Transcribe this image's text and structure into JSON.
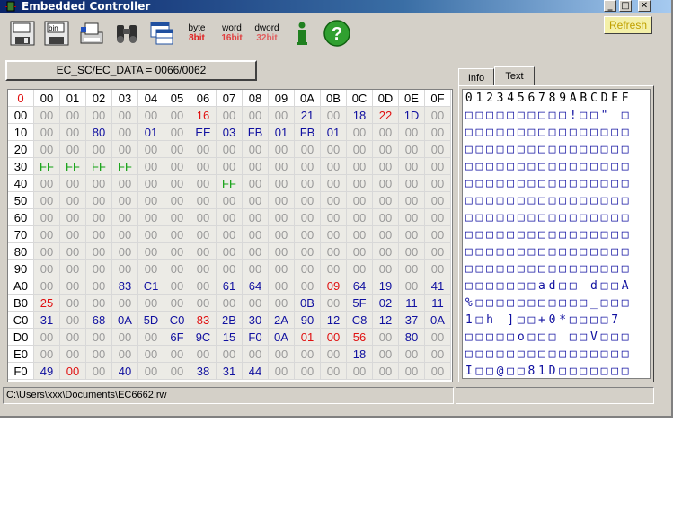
{
  "window": {
    "title": "Embedded Controller",
    "min_btn": "_",
    "max_btn": "□",
    "close_btn": "✕"
  },
  "toolbar": {
    "buttons": [
      "save-icon",
      "save-bin-icon",
      "print-icon",
      "binoculars-icon",
      "table-icon"
    ],
    "byte": {
      "top": "byte",
      "bottom": "8bit"
    },
    "word": {
      "top": "word",
      "bottom": "16bit"
    },
    "dword": {
      "top": "dword",
      "bottom": "32bit"
    },
    "info_icon": "i",
    "help_icon": "?",
    "refresh_label": "Refresh"
  },
  "colors": {
    "zero": "#9a9a9a",
    "blue": "#1010a0",
    "red": "#e01010",
    "green": "#10a010"
  },
  "ec_port_label": "EC_SC/EC_DATA = 0066/0062",
  "hex": {
    "corner": "0",
    "columns": [
      "00",
      "01",
      "02",
      "03",
      "04",
      "05",
      "06",
      "07",
      "08",
      "09",
      "0A",
      "0B",
      "0C",
      "0D",
      "0E",
      "0F"
    ],
    "rows": [
      {
        "label": "00",
        "cells": [
          "00",
          "00",
          "00",
          "00",
          "00",
          "00",
          "16",
          "00",
          "00",
          "00",
          "21",
          "00",
          "18",
          "22",
          "1D",
          "00"
        ],
        "colors": [
          "z",
          "z",
          "z",
          "z",
          "z",
          "z",
          "r",
          "z",
          "z",
          "z",
          "b",
          "z",
          "b",
          "r",
          "b",
          "z"
        ]
      },
      {
        "label": "10",
        "cells": [
          "00",
          "00",
          "80",
          "00",
          "01",
          "00",
          "EE",
          "03",
          "FB",
          "01",
          "FB",
          "01",
          "00",
          "00",
          "00",
          "00"
        ],
        "colors": [
          "z",
          "z",
          "b",
          "z",
          "b",
          "z",
          "b",
          "b",
          "b",
          "b",
          "b",
          "b",
          "z",
          "z",
          "z",
          "z"
        ]
      },
      {
        "label": "20",
        "cells": [
          "00",
          "00",
          "00",
          "00",
          "00",
          "00",
          "00",
          "00",
          "00",
          "00",
          "00",
          "00",
          "00",
          "00",
          "00",
          "00"
        ],
        "colors": [
          "z",
          "z",
          "z",
          "z",
          "z",
          "z",
          "z",
          "z",
          "z",
          "z",
          "z",
          "z",
          "z",
          "z",
          "z",
          "z"
        ]
      },
      {
        "label": "30",
        "cells": [
          "FF",
          "FF",
          "FF",
          "FF",
          "00",
          "00",
          "00",
          "00",
          "00",
          "00",
          "00",
          "00",
          "00",
          "00",
          "00",
          "00"
        ],
        "colors": [
          "g",
          "g",
          "g",
          "g",
          "z",
          "z",
          "z",
          "z",
          "z",
          "z",
          "z",
          "z",
          "z",
          "z",
          "z",
          "z"
        ]
      },
      {
        "label": "40",
        "cells": [
          "00",
          "00",
          "00",
          "00",
          "00",
          "00",
          "00",
          "FF",
          "00",
          "00",
          "00",
          "00",
          "00",
          "00",
          "00",
          "00"
        ],
        "colors": [
          "z",
          "z",
          "z",
          "z",
          "z",
          "z",
          "z",
          "g",
          "z",
          "z",
          "z",
          "z",
          "z",
          "z",
          "z",
          "z"
        ]
      },
      {
        "label": "50",
        "cells": [
          "00",
          "00",
          "00",
          "00",
          "00",
          "00",
          "00",
          "00",
          "00",
          "00",
          "00",
          "00",
          "00",
          "00",
          "00",
          "00"
        ],
        "colors": [
          "z",
          "z",
          "z",
          "z",
          "z",
          "z",
          "z",
          "z",
          "z",
          "z",
          "z",
          "z",
          "z",
          "z",
          "z",
          "z"
        ]
      },
      {
        "label": "60",
        "cells": [
          "00",
          "00",
          "00",
          "00",
          "00",
          "00",
          "00",
          "00",
          "00",
          "00",
          "00",
          "00",
          "00",
          "00",
          "00",
          "00"
        ],
        "colors": [
          "z",
          "z",
          "z",
          "z",
          "z",
          "z",
          "z",
          "z",
          "z",
          "z",
          "z",
          "z",
          "z",
          "z",
          "z",
          "z"
        ]
      },
      {
        "label": "70",
        "cells": [
          "00",
          "00",
          "00",
          "00",
          "00",
          "00",
          "00",
          "00",
          "00",
          "00",
          "00",
          "00",
          "00",
          "00",
          "00",
          "00"
        ],
        "colors": [
          "z",
          "z",
          "z",
          "z",
          "z",
          "z",
          "z",
          "z",
          "z",
          "z",
          "z",
          "z",
          "z",
          "z",
          "z",
          "z"
        ]
      },
      {
        "label": "80",
        "cells": [
          "00",
          "00",
          "00",
          "00",
          "00",
          "00",
          "00",
          "00",
          "00",
          "00",
          "00",
          "00",
          "00",
          "00",
          "00",
          "00"
        ],
        "colors": [
          "z",
          "z",
          "z",
          "z",
          "z",
          "z",
          "z",
          "z",
          "z",
          "z",
          "z",
          "z",
          "z",
          "z",
          "z",
          "z"
        ]
      },
      {
        "label": "90",
        "cells": [
          "00",
          "00",
          "00",
          "00",
          "00",
          "00",
          "00",
          "00",
          "00",
          "00",
          "00",
          "00",
          "00",
          "00",
          "00",
          "00"
        ],
        "colors": [
          "z",
          "z",
          "z",
          "z",
          "z",
          "z",
          "z",
          "z",
          "z",
          "z",
          "z",
          "z",
          "z",
          "z",
          "z",
          "z"
        ]
      },
      {
        "label": "A0",
        "cells": [
          "00",
          "00",
          "00",
          "83",
          "C1",
          "00",
          "00",
          "61",
          "64",
          "00",
          "00",
          "09",
          "64",
          "19",
          "00",
          "41"
        ],
        "colors": [
          "z",
          "z",
          "z",
          "b",
          "b",
          "z",
          "z",
          "b",
          "b",
          "z",
          "z",
          "r",
          "b",
          "b",
          "z",
          "b"
        ]
      },
      {
        "label": "B0",
        "cells": [
          "25",
          "00",
          "00",
          "00",
          "00",
          "00",
          "00",
          "00",
          "00",
          "00",
          "0B",
          "00",
          "5F",
          "02",
          "11",
          "11"
        ],
        "colors": [
          "r",
          "z",
          "z",
          "z",
          "z",
          "z",
          "z",
          "z",
          "z",
          "z",
          "b",
          "z",
          "b",
          "b",
          "b",
          "b"
        ]
      },
      {
        "label": "C0",
        "cells": [
          "31",
          "00",
          "68",
          "0A",
          "5D",
          "C0",
          "83",
          "2B",
          "30",
          "2A",
          "90",
          "12",
          "C8",
          "12",
          "37",
          "0A"
        ],
        "colors": [
          "b",
          "z",
          "b",
          "b",
          "b",
          "b",
          "r",
          "b",
          "b",
          "b",
          "b",
          "b",
          "b",
          "b",
          "b",
          "b"
        ]
      },
      {
        "label": "D0",
        "cells": [
          "00",
          "00",
          "00",
          "00",
          "00",
          "6F",
          "9C",
          "15",
          "F0",
          "0A",
          "01",
          "00",
          "56",
          "00",
          "80",
          "00"
        ],
        "colors": [
          "z",
          "z",
          "z",
          "z",
          "z",
          "b",
          "b",
          "b",
          "b",
          "b",
          "r",
          "r",
          "r",
          "z",
          "b",
          "z"
        ]
      },
      {
        "label": "E0",
        "cells": [
          "00",
          "00",
          "00",
          "00",
          "00",
          "00",
          "00",
          "00",
          "00",
          "00",
          "00",
          "00",
          "18",
          "00",
          "00",
          "00"
        ],
        "colors": [
          "z",
          "z",
          "z",
          "z",
          "z",
          "z",
          "z",
          "z",
          "z",
          "z",
          "z",
          "z",
          "b",
          "z",
          "z",
          "z"
        ]
      },
      {
        "label": "F0",
        "cells": [
          "49",
          "00",
          "00",
          "40",
          "00",
          "00",
          "38",
          "31",
          "44",
          "00",
          "00",
          "00",
          "00",
          "00",
          "00",
          "00"
        ],
        "colors": [
          "b",
          "r",
          "z",
          "b",
          "z",
          "z",
          "b",
          "b",
          "b",
          "z",
          "z",
          "z",
          "z",
          "z",
          "z",
          "z"
        ]
      }
    ]
  },
  "tabs": [
    {
      "label": "Info"
    },
    {
      "label": "Text"
    }
  ],
  "text": {
    "header": [
      "0",
      "1",
      "2",
      "3",
      "4",
      "5",
      "6",
      "7",
      "8",
      "9",
      "A",
      "B",
      "C",
      "D",
      "E",
      "F"
    ],
    "rows": [
      [
        "□",
        "□",
        "□",
        "□",
        "□",
        "□",
        "□",
        "□",
        "□",
        "□",
        "!",
        "□",
        "□",
        "\"",
        "",
        "□"
      ],
      [
        "□",
        "□",
        "□",
        "□",
        "□",
        "□",
        "□",
        "□",
        "□",
        "□",
        "□",
        "□",
        "□",
        "□",
        "□",
        "□"
      ],
      [
        "□",
        "□",
        "□",
        "□",
        "□",
        "□",
        "□",
        "□",
        "□",
        "□",
        "□",
        "□",
        "□",
        "□",
        "□",
        "□"
      ],
      [
        "□",
        "□",
        "□",
        "□",
        "□",
        "□",
        "□",
        "□",
        "□",
        "□",
        "□",
        "□",
        "□",
        "□",
        "□",
        "□"
      ],
      [
        "□",
        "□",
        "□",
        "□",
        "□",
        "□",
        "□",
        "□",
        "□",
        "□",
        "□",
        "□",
        "□",
        "□",
        "□",
        "□"
      ],
      [
        "□",
        "□",
        "□",
        "□",
        "□",
        "□",
        "□",
        "□",
        "□",
        "□",
        "□",
        "□",
        "□",
        "□",
        "□",
        "□"
      ],
      [
        "□",
        "□",
        "□",
        "□",
        "□",
        "□",
        "□",
        "□",
        "□",
        "□",
        "□",
        "□",
        "□",
        "□",
        "□",
        "□"
      ],
      [
        "□",
        "□",
        "□",
        "□",
        "□",
        "□",
        "□",
        "□",
        "□",
        "□",
        "□",
        "□",
        "□",
        "□",
        "□",
        "□"
      ],
      [
        "□",
        "□",
        "□",
        "□",
        "□",
        "□",
        "□",
        "□",
        "□",
        "□",
        "□",
        "□",
        "□",
        "□",
        "□",
        "□"
      ],
      [
        "□",
        "□",
        "□",
        "□",
        "□",
        "□",
        "□",
        "□",
        "□",
        "□",
        "□",
        "□",
        "□",
        "□",
        "□",
        "□"
      ],
      [
        "□",
        "□",
        "□",
        "□",
        "□",
        "□",
        "□",
        "a",
        "d",
        "□",
        "□",
        "",
        "d",
        "□",
        "□",
        "A"
      ],
      [
        "%",
        "□",
        "□",
        "□",
        "□",
        "□",
        "□",
        "□",
        "□",
        "□",
        "□",
        "□",
        "_",
        "□",
        "□",
        "□"
      ],
      [
        "1",
        "□",
        "h",
        "",
        "]",
        "□",
        "□",
        "+",
        "0",
        "*",
        "□",
        "□",
        "□",
        "□",
        "7",
        ""
      ],
      [
        "□",
        "□",
        "□",
        "□",
        "□",
        "o",
        "□",
        "□",
        "□",
        "",
        "□",
        "□",
        "V",
        "□",
        "□",
        "□"
      ],
      [
        "□",
        "□",
        "□",
        "□",
        "□",
        "□",
        "□",
        "□",
        "□",
        "□",
        "□",
        "□",
        "□",
        "□",
        "□",
        "□"
      ],
      [
        "I",
        "□",
        "□",
        "@",
        "□",
        "□",
        "8",
        "1",
        "D",
        "□",
        "□",
        "□",
        "□",
        "□",
        "□",
        "□"
      ]
    ]
  },
  "status": {
    "path": "C:\\Users\\xxx\\Documents\\EC6662.rw",
    "right": ""
  }
}
